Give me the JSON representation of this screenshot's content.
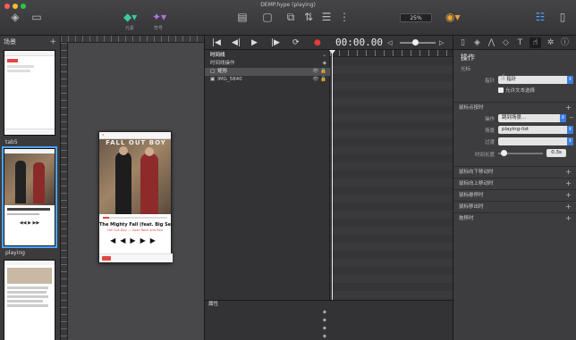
{
  "window": {
    "title": "DEMP.hype (playing)"
  },
  "toolbar": {
    "left": [
      {
        "label": ""
      },
      {
        "label": ""
      }
    ],
    "center": [
      {
        "label": "元素"
      },
      {
        "label": "符号"
      }
    ],
    "mid": [
      {
        "label": ""
      },
      {
        "label": ""
      },
      {
        "label": ""
      },
      {
        "label": ""
      },
      {
        "label": ""
      },
      {
        "label": ""
      }
    ],
    "zoom": "25%",
    "right": [
      {
        "label": ""
      },
      {
        "label": ""
      },
      {
        "label": ""
      }
    ]
  },
  "scenes": {
    "header": "场景",
    "items": [
      {
        "name": "tab5"
      },
      {
        "name": "playing"
      },
      {
        "name": ""
      }
    ]
  },
  "phone": {
    "status": "",
    "song_title": "The Mighty Fall (feat. Big Sean)",
    "song_artist": "Fall Out Boy — Save Rock and Roll",
    "album_text": "FALL OUT BOY"
  },
  "timeline": {
    "timecode": "00:00.00",
    "layers": [
      {
        "name": "时间线"
      },
      {
        "name": "时间线操作"
      },
      {
        "name": "矩形"
      },
      {
        "name": "IMG_5840"
      }
    ],
    "properties_header": "属性",
    "properties_right": "",
    "properties": [
      {
        "name": ""
      },
      {
        "name": ""
      },
      {
        "name": ""
      },
      {
        "name": ""
      }
    ]
  },
  "inspector": {
    "title": "操作",
    "section_button": "光标",
    "cursor_label": "指针",
    "cursor_value": "指针",
    "allow_text_select": "允许文本选择",
    "mouse_click": "鼠标点按时",
    "mouse_click_hint": "",
    "action_label": "操作",
    "action_value": "跳到场景...",
    "scene_label": "场景",
    "scene_value": "playing-list",
    "transition_label": "过渡",
    "transition_value": "",
    "duration_label": "时间长度",
    "duration_value": "0.3s",
    "mouse_down": "鼠标向下移动时",
    "mouse_down_hint": "",
    "mouse_up": "鼠标向上移动时",
    "mouse_up_hint": "",
    "mouse_over": "鼠标悬停时",
    "mouse_out": "鼠标移出时",
    "drag": "拖移时"
  }
}
